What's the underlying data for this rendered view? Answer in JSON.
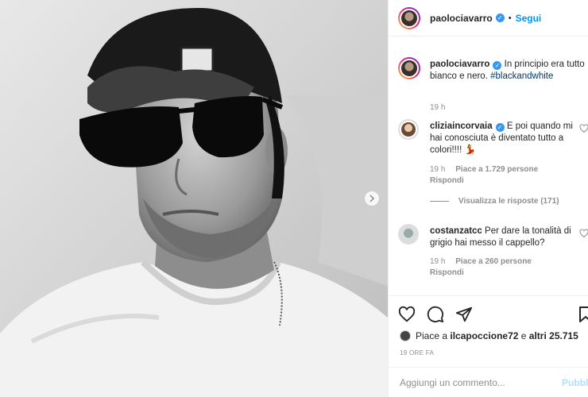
{
  "post": {
    "username": "paolociavarro",
    "follow_label": "Segui",
    "separator": "•"
  },
  "caption": {
    "username": "paolociavarro",
    "text": "In principio era tutto bianco e nero.",
    "hashtag": "#blackandwhite",
    "time": "19 h"
  },
  "comments": [
    {
      "username": "cliziaincorvaia",
      "text": "E poi quando mi hai conosciuta è diventato tutto a colori!!!! 💃",
      "time": "19 h",
      "likes": "Piace a 1.729 persone",
      "reply": "Rispondi",
      "view_replies": "Visualizza le risposte (171)"
    },
    {
      "username": "costanzatcc",
      "text": "Per dare la tonalità di grigio hai messo il cappello?",
      "time": "19 h",
      "likes": "Piace a 260 persone",
      "reply": "Rispondi"
    }
  ],
  "footer": {
    "likes_prefix": "Piace a ",
    "likes_user": "ilcapoccione72",
    "likes_mid": " e ",
    "likes_others": "altri 25.715",
    "time_ago": "19 ORE FA",
    "comment_placeholder": "Aggiungi un commento...",
    "publish_label": "Pubblica"
  },
  "icons": {
    "like": "heart-icon",
    "comment": "comment-icon",
    "share": "share-icon",
    "save": "bookmark-icon",
    "next": "chevron-right-icon"
  },
  "colors": {
    "link_blue": "#0095f6",
    "verified_blue": "#3897f0",
    "hashtag": "#00376b",
    "muted": "#8e8e8e"
  }
}
